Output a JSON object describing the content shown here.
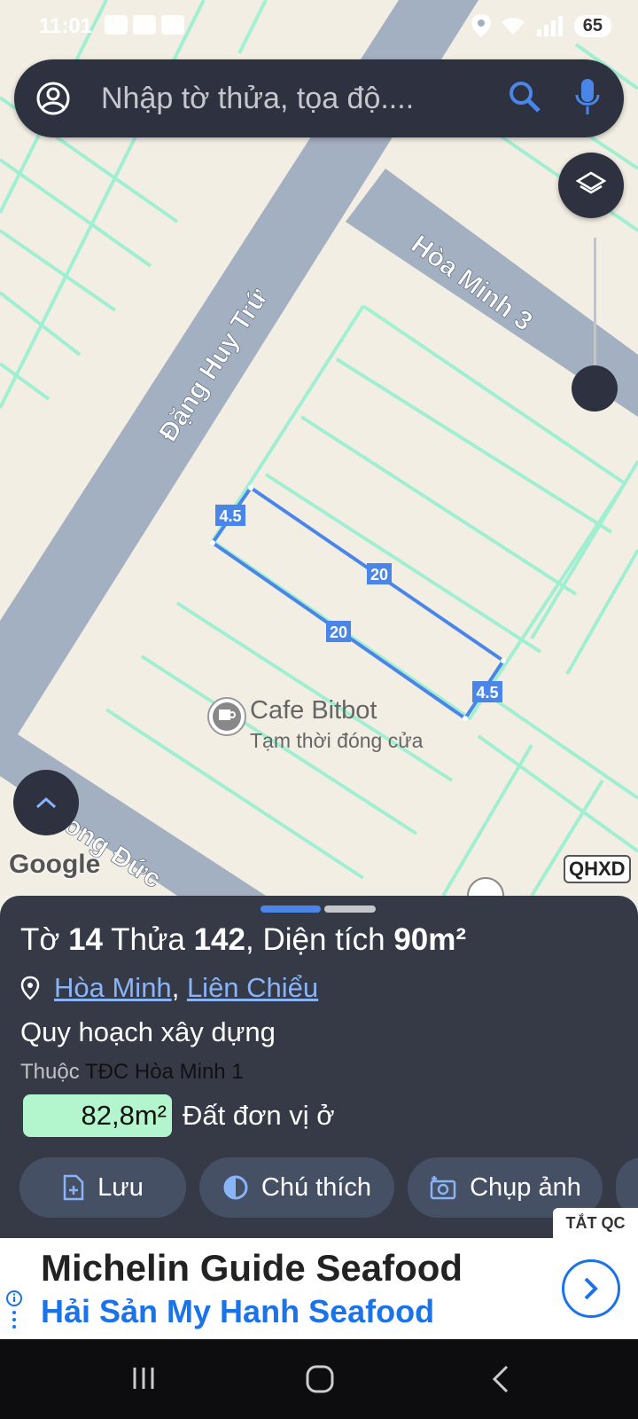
{
  "status_bar": {
    "time": "11:01",
    "battery": "65"
  },
  "search": {
    "placeholder": "Nhập tờ thửa, tọa độ...."
  },
  "map": {
    "streets": [
      "Đặng Huy Trứ",
      "Hòa Minh 3",
      "ong Đức"
    ],
    "parcel_dims": {
      "side_a": "4.5",
      "side_b": "20",
      "side_c": "20",
      "side_d": "4.5"
    },
    "poi_name": "Cafe Bitbot",
    "poi_status": "Tạm thời đóng cửa",
    "google_logo": "Google",
    "overlay_badge": "QHXD"
  },
  "parcel": {
    "prefix_sheet": "Tờ",
    "sheet": "14",
    "prefix_plot": "Thửa",
    "plot": "142",
    "prefix_area": ", Diện tích",
    "area": "90m²",
    "ward": "Hòa Minh",
    "separator": ",",
    "district": "Liên Chiểu",
    "planning_title": "Quy hoạch xây dựng",
    "belongs_prefix": "Thuộc",
    "zone": "TĐC Hòa Minh 1",
    "zone_area": "82,8m²",
    "land_type": "Đất đơn vị ở",
    "land_color": "#b3f5cc"
  },
  "actions": {
    "save": "Lưu",
    "legend": "Chú thích",
    "photo": "Chụp ảnh"
  },
  "ad": {
    "close_label": "TẮT QC",
    "line1": "Michelin Guide Seafood",
    "line2": "Hải Sản My Hanh Seafood"
  },
  "colors": {
    "accent": "#4a86e8",
    "sheet_bg": "#353a46",
    "road": "#a3b0c1",
    "parcel_line": "#9df0d2"
  }
}
